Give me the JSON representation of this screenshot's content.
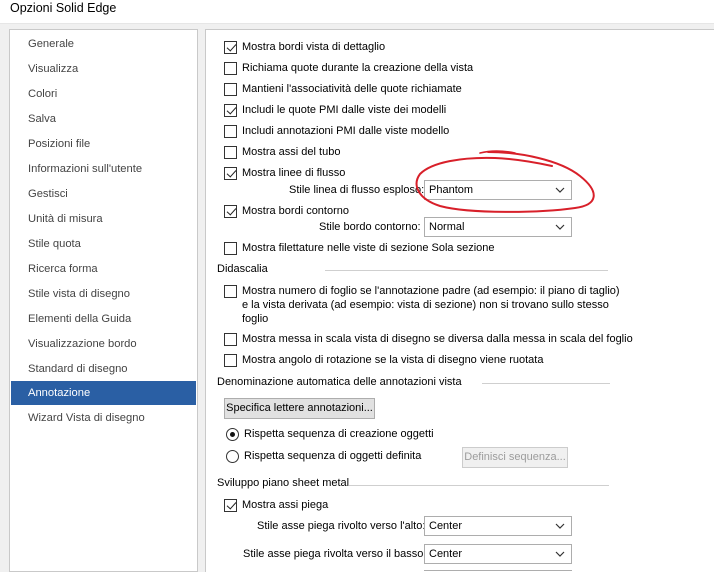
{
  "window": {
    "title": "Opzioni Solid Edge"
  },
  "sidebar": {
    "items": [
      {
        "label": "Generale",
        "selected": false
      },
      {
        "label": "Visualizza",
        "selected": false
      },
      {
        "label": "Colori",
        "selected": false
      },
      {
        "label": "Salva",
        "selected": false
      },
      {
        "label": "Posizioni file",
        "selected": false
      },
      {
        "label": "Informazioni sull'utente",
        "selected": false
      },
      {
        "label": "Gestisci",
        "selected": false
      },
      {
        "label": "Unità di misura",
        "selected": false
      },
      {
        "label": "Stile quota",
        "selected": false
      },
      {
        "label": "Ricerca forma",
        "selected": false
      },
      {
        "label": "Stile vista di disegno",
        "selected": false
      },
      {
        "label": "Elementi della Guida",
        "selected": false
      },
      {
        "label": "Visualizzazione bordo",
        "selected": false
      },
      {
        "label": "Standard di disegno",
        "selected": false
      },
      {
        "label": "Annotazione",
        "selected": true
      },
      {
        "label": "Wizard Vista di disegno",
        "selected": false
      }
    ]
  },
  "options": {
    "detail_edges": {
      "label": "Mostra bordi vista di dettaglio",
      "checked": true
    },
    "retrieve_dims": {
      "label": "Richiama quote durante la creazione della vista",
      "checked": false
    },
    "keep_assoc": {
      "label": "Mantieni l'associatività delle quote richiamate",
      "checked": false
    },
    "include_pmi_dims": {
      "label": "Includi le quote PMI dalle viste dei modelli",
      "checked": true
    },
    "include_pmi_annot": {
      "label": "Includi annotazioni PMI dalle viste modello",
      "checked": false
    },
    "tube_axes": {
      "label": "Mostra assi del tubo",
      "checked": false
    },
    "flow_lines": {
      "label": "Mostra linee di flusso",
      "checked": true
    },
    "flow_style_label": "Stile linea di flusso esploso:",
    "flow_style_value": "Phantom",
    "contour_edges": {
      "label": "Mostra bordi contorno",
      "checked": true
    },
    "contour_style_label": "Stile bordo contorno:",
    "contour_style_value": "Normal",
    "threads": {
      "label": "Mostra filettature nelle viste di sezione Sola sezione",
      "checked": false
    }
  },
  "caption": {
    "header": "Didascalia",
    "sheet_number": {
      "label": "Mostra numero di foglio se l'annotazione padre (ad esempio: il piano di taglio) e la vista derivata (ad esempio: vista di sezione) non si trovano sullo stesso foglio",
      "checked": false
    },
    "scale": {
      "label": "Mostra messa in scala vista di disegno se diversa dalla messa in scala del foglio",
      "checked": false
    },
    "rotation": {
      "label": "Mostra angolo di rotazione se la vista di disegno viene ruotata",
      "checked": false
    }
  },
  "auto_naming": {
    "header": "Denominazione automatica delle annotazioni vista",
    "specify_button": "Specifica lettere annotazioni...",
    "radio_creation": {
      "label": "Rispetta sequenza di creazione oggetti",
      "selected": true
    },
    "radio_defined": {
      "label": "Rispetta sequenza di oggetti definita",
      "selected": false
    },
    "define_button": "Definisci sequenza..."
  },
  "sheet_metal": {
    "header": "Sviluppo piano sheet metal",
    "bend_axes": {
      "label": "Mostra assi piega",
      "checked": true
    },
    "bend_up_label": "Stile asse piega rivolto verso l'alto:",
    "bend_up_value": "Center",
    "bend_down_label": "Stile asse piega rivolta verso il basso:",
    "bend_down_value": "Center"
  },
  "colors": {
    "selected_bg": "#2a5fa4",
    "annotation_ink": "#d8202a"
  }
}
